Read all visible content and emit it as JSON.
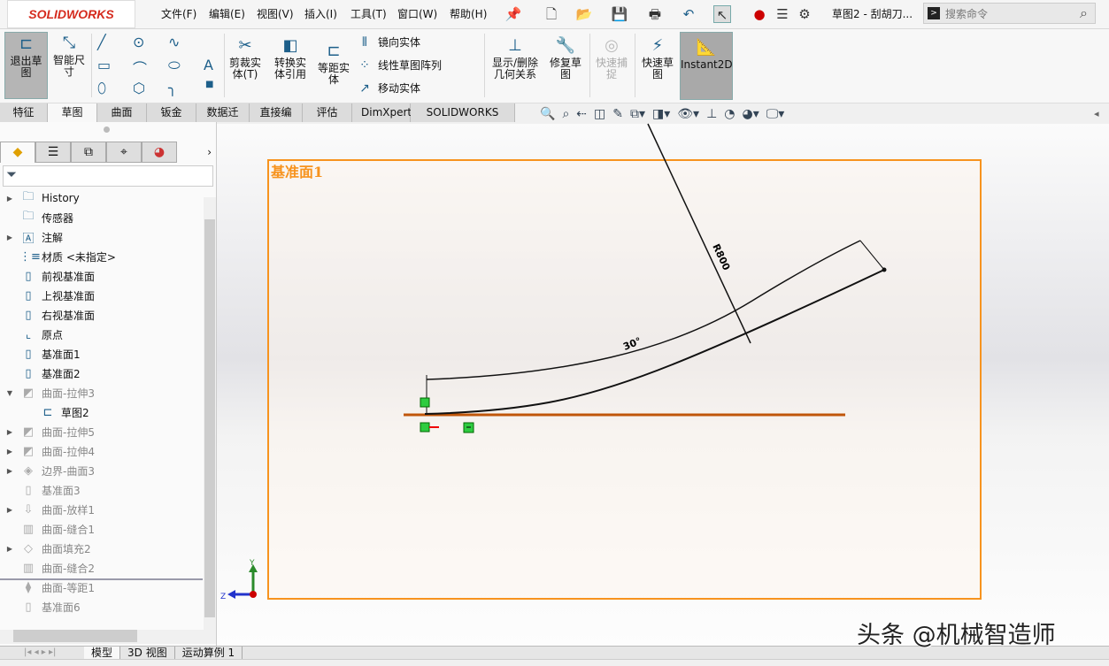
{
  "app": {
    "logo": "SOLIDWORKS",
    "title": "草图2 - 刮胡刀...",
    "search_placeholder": "搜索命令"
  },
  "menu": [
    "文件(F)",
    "编辑(E)",
    "视图(V)",
    "插入(I)",
    "工具(T)",
    "窗口(W)",
    "帮助(H)"
  ],
  "ribbon": {
    "exit_sketch": "退出草图",
    "smart_dim": "智能尺寸",
    "trim": "剪裁实体(T)",
    "convert": "转换实体引用",
    "offset": "等距实体",
    "mirror": "镜向实体",
    "linear_pattern": "线性草图阵列",
    "move": "移动实体",
    "display_relations": "显示/删除几何关系",
    "repair": "修复草图",
    "quick_snap": "快速捕捉",
    "rapid_sketch": "快速草图",
    "instant2d": "Instant2D"
  },
  "tabs": [
    "特征",
    "草图",
    "曲面",
    "钣金",
    "数据迁移",
    "直接编辑",
    "评估",
    "DimXpert",
    "SOLIDWORKS 插件"
  ],
  "active_tab": "草图",
  "tree": [
    {
      "label": "History",
      "icon": "history-folder-icon",
      "expand": true,
      "dim": false
    },
    {
      "label": "传感器",
      "icon": "sensor-folder-icon",
      "expand": false,
      "dim": false
    },
    {
      "label": "注解",
      "icon": "annotation-folder-icon",
      "expand": true,
      "dim": false
    },
    {
      "label": "材质 <未指定>",
      "icon": "material-icon",
      "expand": false,
      "dim": false
    },
    {
      "label": "前视基准面",
      "icon": "plane-icon",
      "expand": false,
      "dim": false
    },
    {
      "label": "上视基准面",
      "icon": "plane-icon",
      "expand": false,
      "dim": false
    },
    {
      "label": "右视基准面",
      "icon": "plane-icon",
      "expand": false,
      "dim": false
    },
    {
      "label": "原点",
      "icon": "origin-icon",
      "expand": false,
      "dim": false
    },
    {
      "label": "基准面1",
      "icon": "plane-icon",
      "expand": false,
      "dim": false
    },
    {
      "label": "基准面2",
      "icon": "plane-icon",
      "expand": false,
      "dim": false
    },
    {
      "label": "曲面-拉伸3",
      "icon": "surface-extrude-icon",
      "expand": "open",
      "dim": true
    },
    {
      "label": "草图2",
      "icon": "sketch-icon",
      "expand": false,
      "dim": false,
      "child": true
    },
    {
      "label": "曲面-拉伸5",
      "icon": "surface-extrude-icon",
      "expand": true,
      "dim": true
    },
    {
      "label": "曲面-拉伸4",
      "icon": "surface-extrude-icon",
      "expand": true,
      "dim": true
    },
    {
      "label": "边界-曲面3",
      "icon": "boundary-surface-icon",
      "expand": true,
      "dim": true
    },
    {
      "label": "基准面3",
      "icon": "plane-icon",
      "expand": false,
      "dim": true
    },
    {
      "label": "曲面-放样1",
      "icon": "surface-loft-icon",
      "expand": true,
      "dim": true
    },
    {
      "label": "曲面-缝合1",
      "icon": "surface-knit-icon",
      "expand": false,
      "dim": true
    },
    {
      "label": "曲面填充2",
      "icon": "surface-fill-icon",
      "expand": true,
      "dim": true
    },
    {
      "label": "曲面-缝合2",
      "icon": "surface-knit-icon",
      "expand": false,
      "dim": true
    },
    {
      "label": "曲面-等距1",
      "icon": "surface-offset-icon",
      "expand": false,
      "dim": true
    },
    {
      "label": "基准面6",
      "icon": "plane-icon",
      "expand": false,
      "dim": true
    }
  ],
  "viewport": {
    "plane_label": "基准面1",
    "dim_radius": "R800",
    "dim_angle": "30°",
    "plane_color": "#f7931e",
    "axis_y": "Y",
    "axis_z": "Z"
  },
  "bottom_tabs": [
    "模型",
    "3D 视图",
    "运动算例 1"
  ],
  "watermark": "头条 @机械智造师"
}
